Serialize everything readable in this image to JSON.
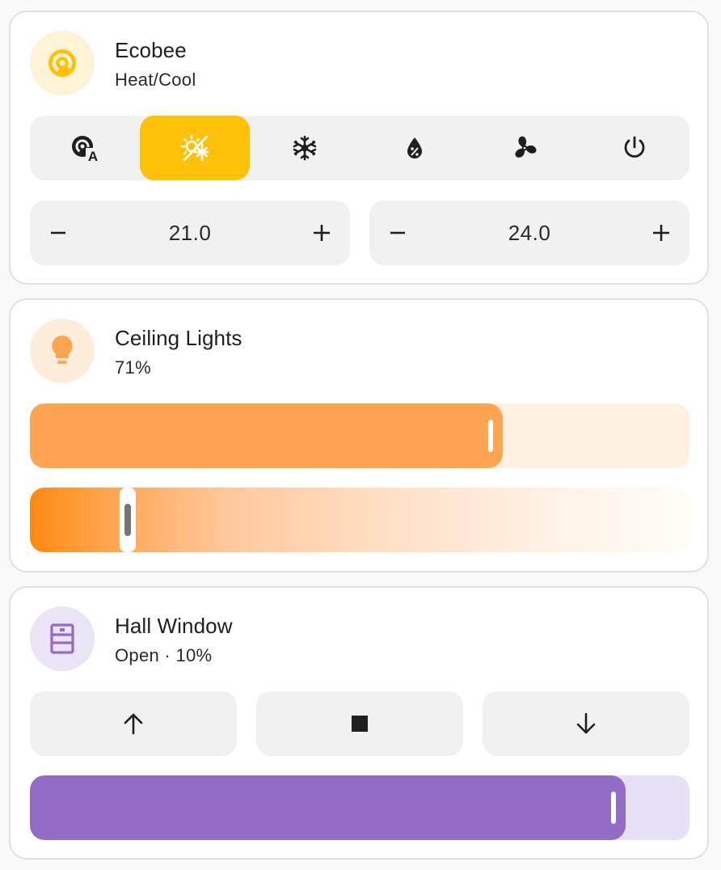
{
  "thermostat": {
    "name": "Ecobee",
    "state": "Heat/Cool",
    "accent": "#ffc107",
    "modes": [
      {
        "name": "auto",
        "icon": "thermostat-auto-icon",
        "active": false
      },
      {
        "name": "heat_cool",
        "icon": "sun-snowflake-icon",
        "active": true
      },
      {
        "name": "cool",
        "icon": "snowflake-icon",
        "active": false
      },
      {
        "name": "dry",
        "icon": "water-percent-icon",
        "active": false
      },
      {
        "name": "fan_only",
        "icon": "fan-icon",
        "active": false
      },
      {
        "name": "off",
        "icon": "power-icon",
        "active": false
      }
    ],
    "low_target": "21.0",
    "high_target": "24.0",
    "minus_symbol": "−",
    "plus_symbol": "+"
  },
  "light": {
    "name": "Ceiling Lights",
    "state": "71%",
    "brightness_percent": 71,
    "color_temp_fraction": 0.148,
    "accent": "#ffa552",
    "icon": "lightbulb-icon"
  },
  "cover": {
    "name": "Hall Window",
    "state": "Open · 10%",
    "position_fraction": 0.903,
    "accent": "#926cc5",
    "icon": "window-icon",
    "buttons": [
      {
        "name": "open",
        "icon": "arrow-up-icon"
      },
      {
        "name": "stop",
        "icon": "stop-icon"
      },
      {
        "name": "close",
        "icon": "arrow-down-icon"
      }
    ]
  }
}
